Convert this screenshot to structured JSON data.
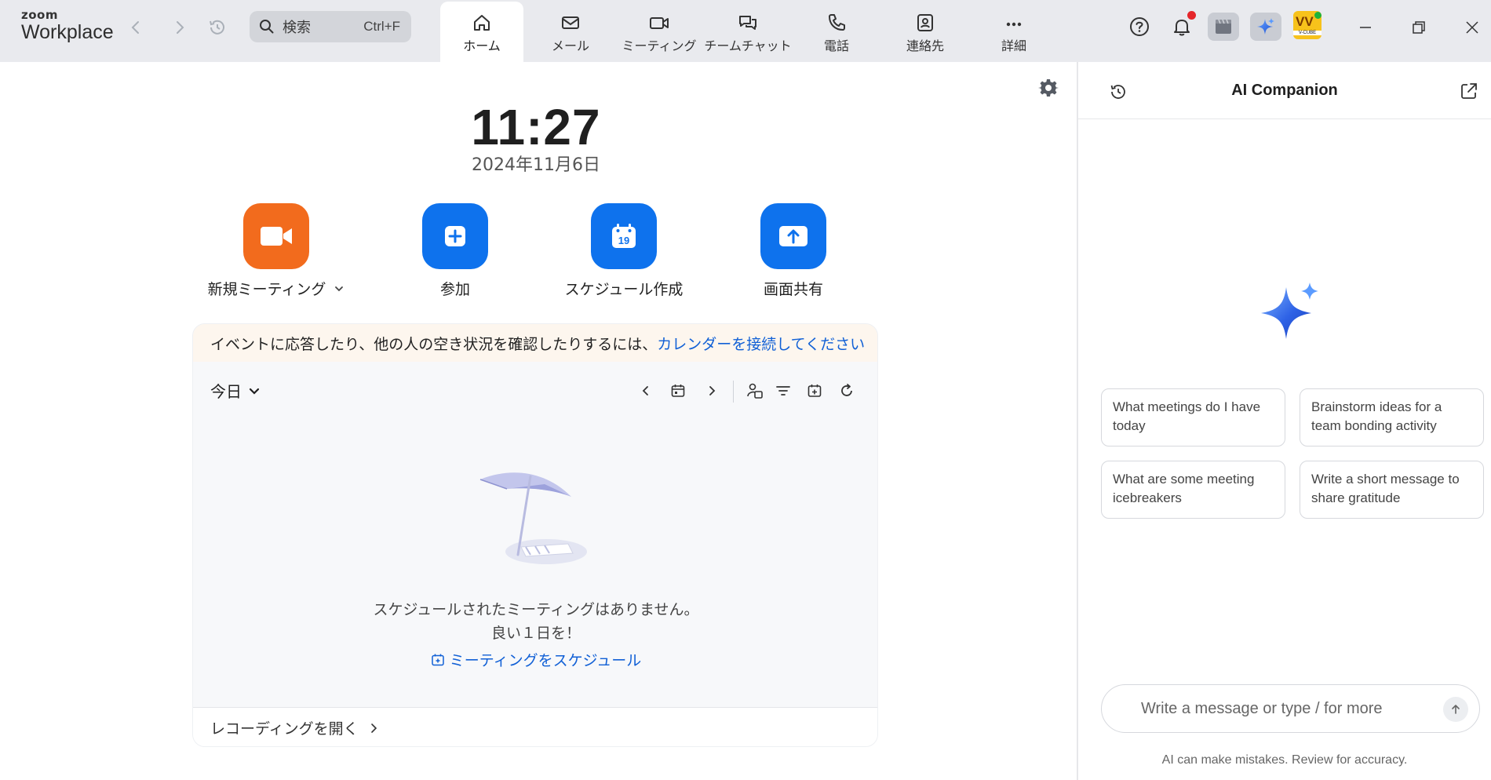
{
  "app": {
    "logo_top": "zoom",
    "logo_bottom": "Workplace"
  },
  "search": {
    "label": "検索",
    "shortcut": "Ctrl+F"
  },
  "tabs": [
    {
      "label": "ホーム",
      "icon": "home-icon",
      "active": true
    },
    {
      "label": "メール",
      "icon": "mail-icon",
      "active": false
    },
    {
      "label": "ミーティング",
      "icon": "video-camera-icon",
      "active": false
    },
    {
      "label": "チームチャット",
      "icon": "chat-bubbles-icon",
      "active": false
    },
    {
      "label": "電話",
      "icon": "phone-icon",
      "active": false
    },
    {
      "label": "連絡先",
      "icon": "contacts-icon",
      "active": false
    },
    {
      "label": "詳細",
      "icon": "more-dots-icon",
      "active": false
    }
  ],
  "header_right": {
    "help_icon": "help-circle-icon",
    "notification_icon": "bell-icon",
    "whiteboard_icon": "clips-icon",
    "ai_icon": "ai-sparkle-icon",
    "avatar_text": "V-CUBE"
  },
  "home": {
    "time": "11:27",
    "date": "2024年11月6日",
    "actions": [
      {
        "label": "新規ミーティング",
        "icon": "video-camera-icon",
        "color": "#f26b1d",
        "dropdown": true
      },
      {
        "label": "参加",
        "icon": "plus-icon",
        "color": "#0e72ed",
        "dropdown": false
      },
      {
        "label": "スケジュール作成",
        "icon": "calendar-19-icon",
        "color": "#0e72ed",
        "dropdown": false
      },
      {
        "label": "画面共有",
        "icon": "share-up-arrow-icon",
        "color": "#0e72ed",
        "dropdown": false
      }
    ],
    "calendar_day": "19"
  },
  "calendar": {
    "banner_text": "イベントに応答したり、他の人の空き状況を確認したりするには、",
    "banner_link": "カレンダーを接続してください",
    "today_label": "今日",
    "empty_line1": "スケジュールされたミーティングはありません。",
    "empty_line2": "良い１日を！",
    "schedule_link": "ミーティングをスケジュール",
    "recordings_label": "レコーディングを開く"
  },
  "ai_companion": {
    "title": "AI Companion",
    "suggestions": [
      "What meetings do I have today",
      "Brainstorm ideas for a team bonding activity",
      "What are some meeting icebreakers",
      "Write a short message to share gratitude"
    ],
    "input_placeholder": "Write a message or type / for more",
    "disclaimer": "AI can make mistakes. Review for accuracy."
  },
  "colors": {
    "accent_blue": "#0e72ed",
    "link_blue": "#1160d6",
    "new_meeting_orange": "#f26b1d",
    "notification_red": "#e5262a",
    "presence_green": "#1fb33a"
  }
}
